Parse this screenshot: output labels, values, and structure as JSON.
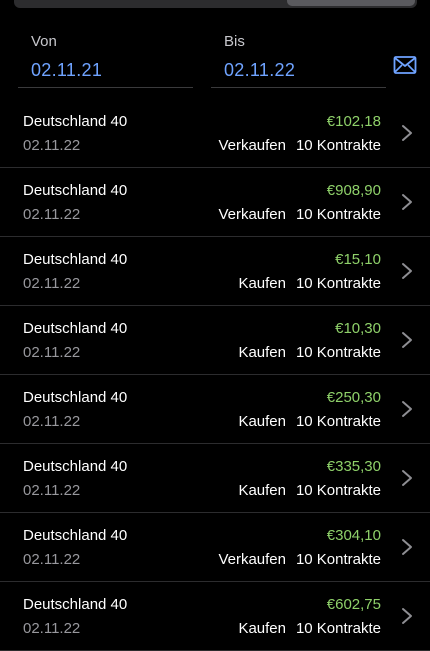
{
  "filter": {
    "from": {
      "label": "Von",
      "value": "02.11.21"
    },
    "to": {
      "label": "Bis",
      "value": "02.11.22"
    }
  },
  "icons": {
    "email": "envelope-icon",
    "row": "chevron-right-icon"
  },
  "colors": {
    "accent": "#6fa3ff",
    "positive": "#8fd16a",
    "background": "#000000"
  },
  "transactions": [
    {
      "name": "Deutschland 40",
      "date": "02.11.22",
      "amount": "€102,18",
      "side": "Verkaufen",
      "contracts": "10 Kontrakte"
    },
    {
      "name": "Deutschland 40",
      "date": "02.11.22",
      "amount": "€908,90",
      "side": "Verkaufen",
      "contracts": "10 Kontrakte"
    },
    {
      "name": "Deutschland 40",
      "date": "02.11.22",
      "amount": "€15,10",
      "side": "Kaufen",
      "contracts": "10 Kontrakte"
    },
    {
      "name": "Deutschland 40",
      "date": "02.11.22",
      "amount": "€10,30",
      "side": "Kaufen",
      "contracts": "10 Kontrakte"
    },
    {
      "name": "Deutschland 40",
      "date": "02.11.22",
      "amount": "€250,30",
      "side": "Kaufen",
      "contracts": "10 Kontrakte"
    },
    {
      "name": "Deutschland 40",
      "date": "02.11.22",
      "amount": "€335,30",
      "side": "Kaufen",
      "contracts": "10 Kontrakte"
    },
    {
      "name": "Deutschland 40",
      "date": "02.11.22",
      "amount": "€304,10",
      "side": "Verkaufen",
      "contracts": "10 Kontrakte"
    },
    {
      "name": "Deutschland 40",
      "date": "02.11.22",
      "amount": "€602,75",
      "side": "Kaufen",
      "contracts": "10 Kontrakte"
    }
  ]
}
